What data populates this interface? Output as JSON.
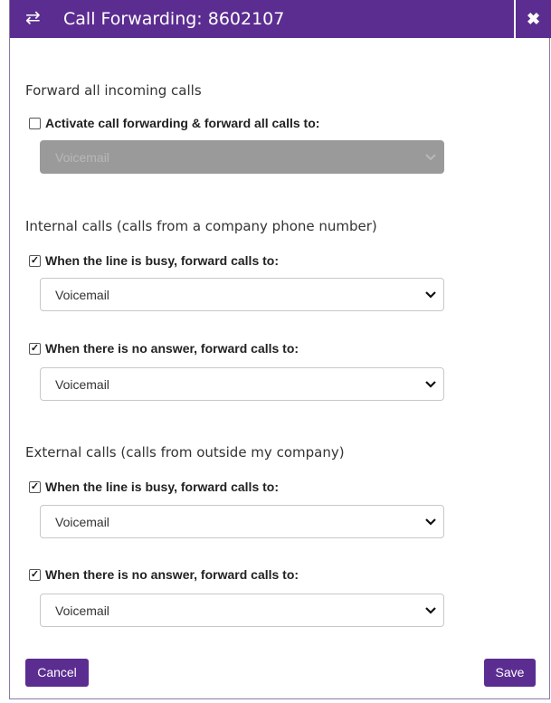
{
  "header": {
    "title": "Call Forwarding: 8602107",
    "icon": "swap-arrows-icon",
    "close_icon": "close-x-icon"
  },
  "forward_all": {
    "section_title": "Forward all incoming calls",
    "checkbox_label": "Activate call forwarding & forward all calls to:",
    "checked": false,
    "select_value": "Voicemail",
    "disabled": true
  },
  "internal": {
    "section_title": "Internal calls (calls from a company phone number)",
    "busy_label": "When the line is busy, forward calls to:",
    "busy_checked": true,
    "busy_value": "Voicemail",
    "noanswer_label": "When there is no answer, forward calls to:",
    "noanswer_checked": true,
    "noanswer_value": "Voicemail"
  },
  "external": {
    "section_title": "External calls (calls from outside my company)",
    "busy_label": "When the line is busy, forward calls to:",
    "busy_checked": true,
    "busy_value": "Voicemail",
    "noanswer_label": "When there is no answer, forward calls to:",
    "noanswer_checked": true,
    "noanswer_value": "Voicemail"
  },
  "footer": {
    "cancel_label": "Cancel",
    "save_label": "Save"
  },
  "colors": {
    "accent": "#5b2d91",
    "disabled_select": "#9a9a9a"
  }
}
